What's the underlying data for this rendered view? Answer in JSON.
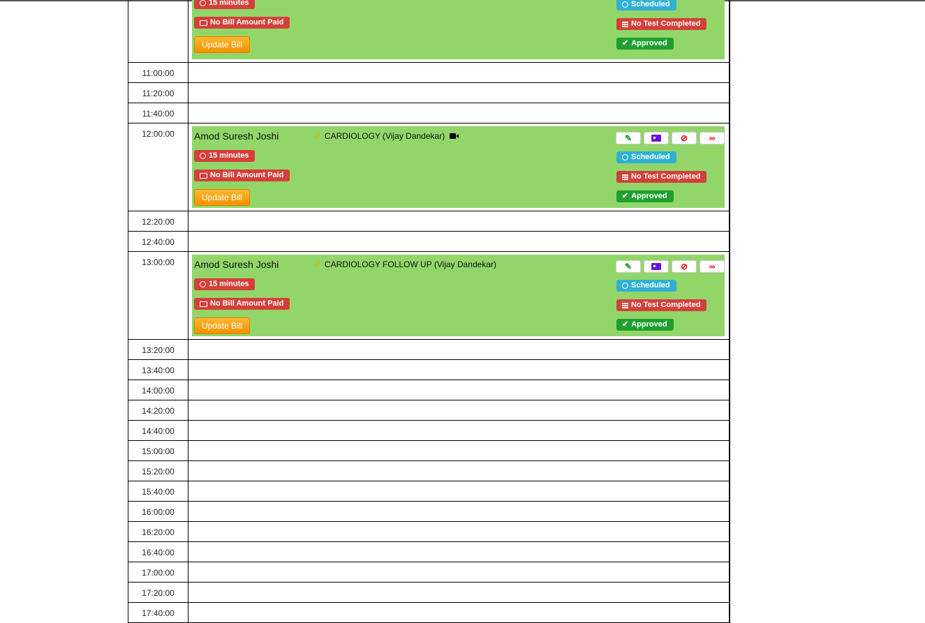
{
  "schedule": {
    "first_appt": {
      "duration": "15 minutes",
      "bill": "No Bill Amount Paid",
      "update": "Update Bill",
      "scheduled": "Scheduled",
      "tests": "No Test Completed",
      "approved": "Approved"
    },
    "slots_a": [
      "11:00:00",
      "11:20:00",
      "11:40:00"
    ],
    "appt1": {
      "time": "12:00:00",
      "patient": "Amod Suresh Joshi",
      "service": "CARDIOLOGY (Vijay Dandekar)",
      "duration": "15 minutes",
      "bill": "No Bill Amount Paid",
      "update": "Update Bill",
      "scheduled": "Scheduled",
      "tests": "No Test Completed",
      "approved": "Approved"
    },
    "slots_b": [
      "12:20:00",
      "12:40:00"
    ],
    "appt2": {
      "time": "13:00:00",
      "patient": "Amod Suresh Joshi",
      "service": "CARDIOLOGY FOLLOW UP (Vijay Dandekar)",
      "duration": "15 minutes",
      "bill": "No Bill Amount Paid",
      "update": "Update Bill",
      "scheduled": "Scheduled",
      "tests": "No Test Completed",
      "approved": "Approved"
    },
    "slots_c": [
      "13:20:00",
      "13:40:00",
      "14:00:00",
      "14:20:00",
      "14:40:00",
      "15:00:00",
      "15:20:00",
      "15:40:00",
      "16:00:00",
      "16:20:00",
      "16:40:00",
      "17:00:00",
      "17:20:00",
      "17:40:00"
    ]
  },
  "icons": {
    "edit": "edit-icon",
    "card": "id-card-icon",
    "cancel": "ban-icon",
    "link": "link-icon"
  },
  "colors": {
    "appointment_bg": "#92d669",
    "danger": "#d43f3a",
    "info": "#31b0d5",
    "success": "#1e9f2f",
    "warning": "#f39200"
  }
}
